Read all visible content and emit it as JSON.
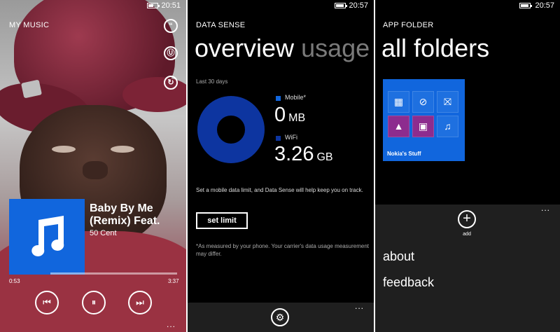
{
  "music": {
    "status_time": "20:51",
    "battery_level": 0.55,
    "header": "MY MUSIC",
    "side_buttons": [
      "“",
      "Ⓤ",
      "↻"
    ],
    "song_title_line1": "Baby By Me",
    "song_title_line2": "(Remix) Feat.",
    "artist": "50 Cent",
    "elapsed": "0:53",
    "total": "3:37",
    "progress": 0.245,
    "controls": {
      "prev": "⏮",
      "pause": "⏸",
      "next": "⏭"
    },
    "more": "..."
  },
  "data_sense": {
    "status_time": "20:57",
    "battery_level": 0.85,
    "header": "DATA SENSE",
    "pivot_active": "overview",
    "pivot_next": "usage",
    "period": "Last 30 days",
    "mobile_label": "Mobile*",
    "mobile_value": "0",
    "mobile_unit": "MB",
    "wifi_label": "WiFi",
    "wifi_value": "3.26",
    "wifi_unit": "GB",
    "mobile_color": "#1166dd",
    "wifi_color": "#0d35a0",
    "info": "Set a mobile data limit, and Data Sense will help keep you on track.",
    "set_limit": "set limit",
    "note": "*As measured by your phone. Your carrier's data usage measurement may differ.",
    "more": "..."
  },
  "app_folder": {
    "status_time": "20:57",
    "battery_level": 0.85,
    "header": "APP FOLDER",
    "title": "all folders",
    "folder_name": "Nokia's Stuff",
    "add_label": "add",
    "menu": [
      "about",
      "feedback"
    ],
    "more": "..."
  }
}
